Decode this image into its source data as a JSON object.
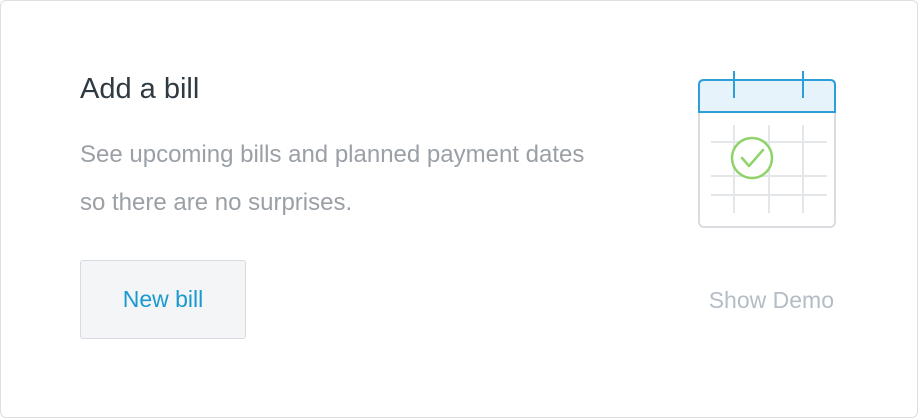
{
  "card": {
    "title": "Add a bill",
    "description": "See upcoming bills and planned payment dates so there are no surprises.",
    "primary_button_label": "New bill",
    "secondary_link_label": "Show Demo",
    "illustration_icon": "calendar-check-icon"
  },
  "colors": {
    "title": "#2f3941",
    "description": "#9aa0a6",
    "button_text": "#1a99d0",
    "button_background": "#f3f5f7",
    "link": "#b4bcc5",
    "calendar_accent": "#2d9fd8",
    "calendar_header": "#e6f3fa",
    "check": "#8fd36a"
  }
}
